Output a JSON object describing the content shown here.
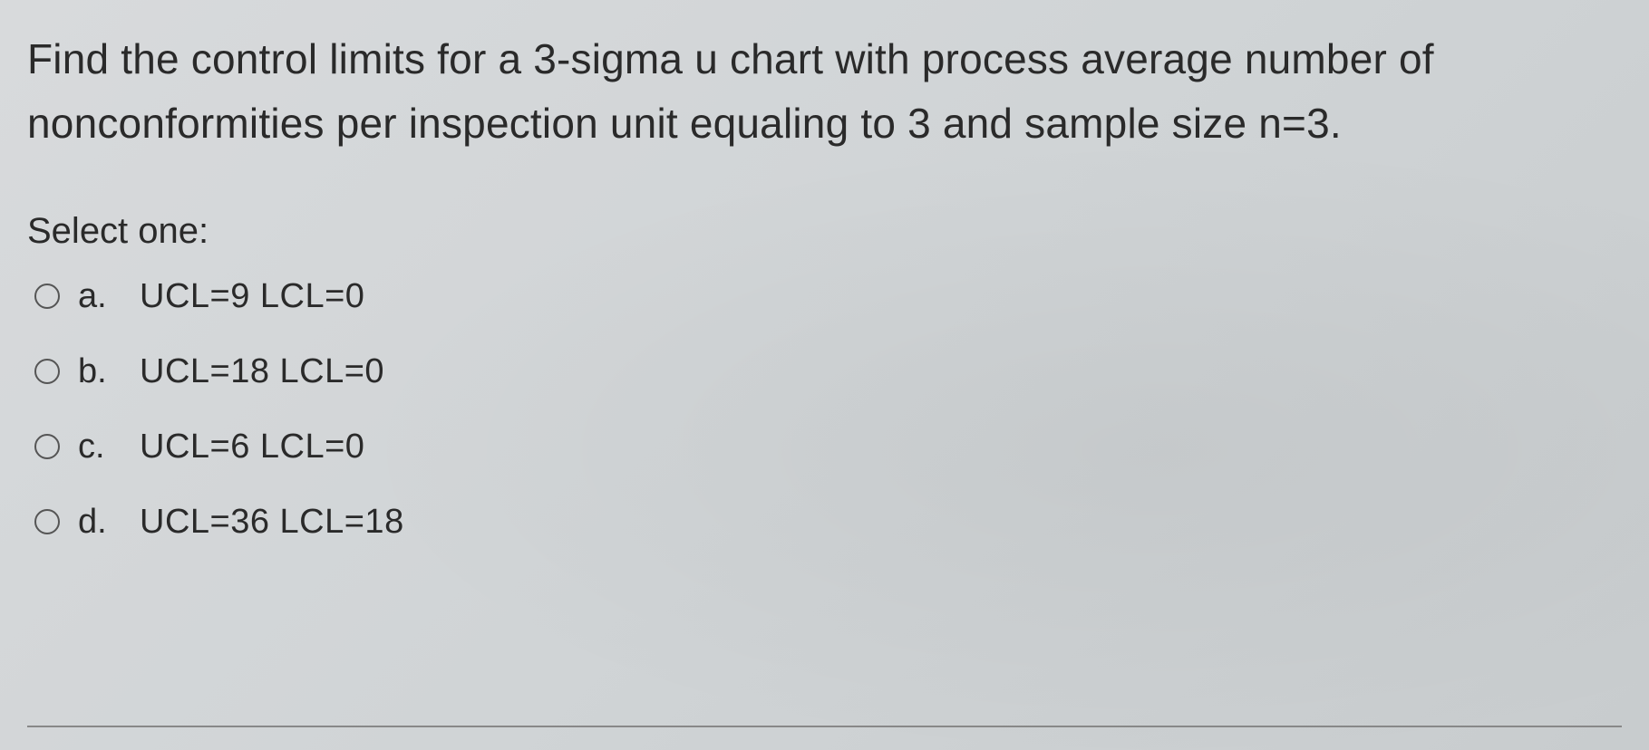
{
  "question": "Find the control limits for a 3-sigma u chart with process average number of nonconformities per inspection unit equaling to 3 and sample size n=3.",
  "select_label": "Select one:",
  "options": [
    {
      "letter": "a.",
      "text": "UCL=9 LCL=0"
    },
    {
      "letter": "b.",
      "text": "UCL=18 LCL=0"
    },
    {
      "letter": "c.",
      "text": "UCL=6 LCL=0"
    },
    {
      "letter": "d.",
      "text": "UCL=36 LCL=18"
    }
  ]
}
